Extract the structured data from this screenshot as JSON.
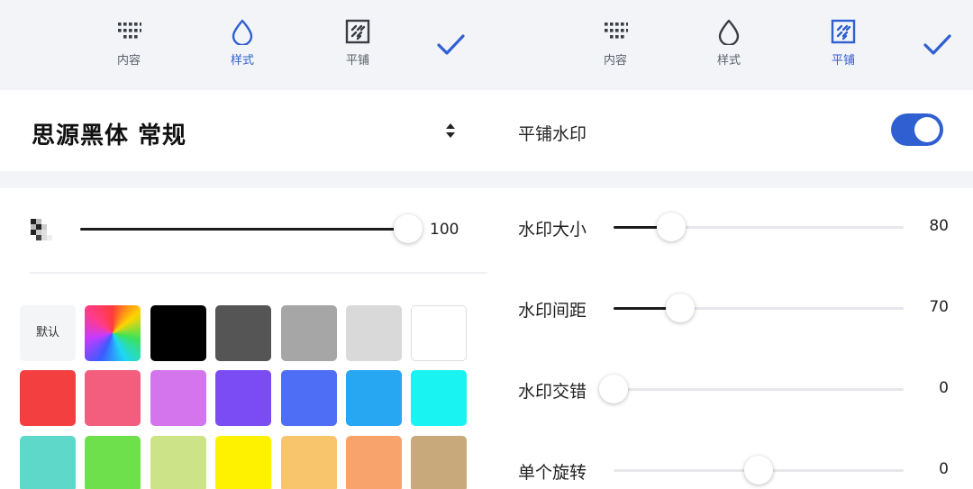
{
  "left_panel": {
    "tabs": [
      {
        "label": "内容",
        "icon": "grid-icon",
        "active": false
      },
      {
        "label": "样式",
        "icon": "drop-icon",
        "active": true
      },
      {
        "label": "平铺",
        "icon": "tile-icon",
        "active": false
      }
    ],
    "confirm_icon": "checkmark-icon",
    "font_name": "思源黑体 常规",
    "opacity": {
      "value_label": "100",
      "fraction": 1.0
    },
    "colors": {
      "default_label": "默认",
      "rows": [
        [
          "default",
          "rainbow",
          "#000000",
          "#555555",
          "#a6a6a6",
          "#d9d9d9",
          "#ffffff"
        ],
        [
          "#f33f3f",
          "#f35d7e",
          "#d575ee",
          "#7b4bf4",
          "#4e6ff5",
          "#27a6f2",
          "#19f3f2"
        ],
        [
          "#5ed8c8",
          "#6ee04b",
          "#cde388",
          "#fff200",
          "#f8c46c",
          "#f7a36b",
          "#c8a97b"
        ]
      ]
    }
  },
  "right_panel": {
    "tabs": [
      {
        "label": "内容",
        "icon": "grid-icon",
        "active": false
      },
      {
        "label": "样式",
        "icon": "drop-icon",
        "active": false
      },
      {
        "label": "平铺",
        "icon": "tile-icon",
        "active": true
      }
    ],
    "confirm_icon": "checkmark-icon",
    "tile_watermark": {
      "label": "平铺水印",
      "on": true
    },
    "sliders": [
      {
        "label": "水印大小",
        "value_label": "80",
        "fraction": 0.2
      },
      {
        "label": "水印间距",
        "value_label": "70",
        "fraction": 0.23
      },
      {
        "label": "水印交错",
        "value_label": "0",
        "fraction": 0.0
      },
      {
        "label": "单个旋转",
        "value_label": "0",
        "fraction": 0.5
      }
    ]
  },
  "colors": {
    "accent": "#2f5fd0",
    "topbar_bg": "#f3f4f8",
    "slider_fill": "#1c1c1c"
  }
}
